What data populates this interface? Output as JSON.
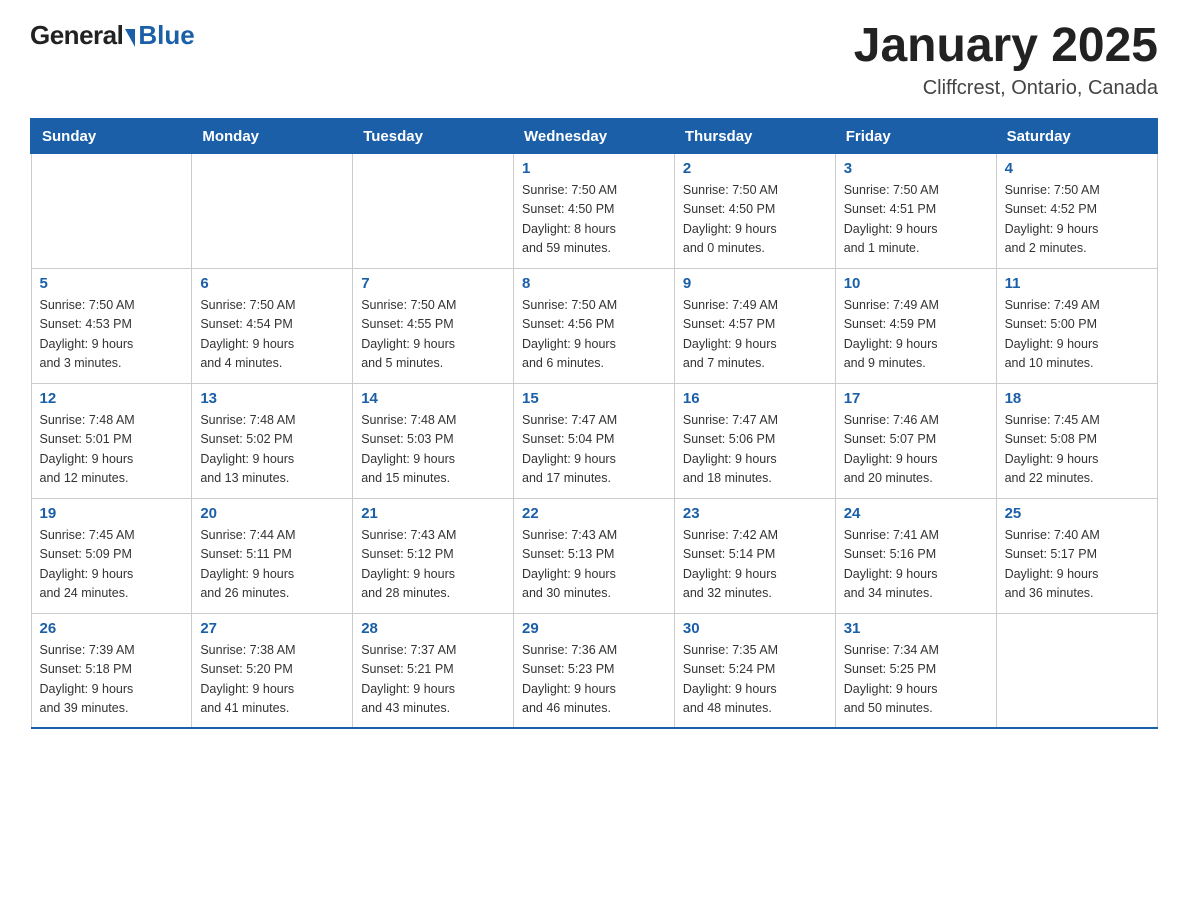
{
  "logo": {
    "general": "General",
    "blue": "Blue",
    "subtitle": ""
  },
  "header": {
    "month_year": "January 2025",
    "location": "Cliffcrest, Ontario, Canada"
  },
  "weekdays": [
    "Sunday",
    "Monday",
    "Tuesday",
    "Wednesday",
    "Thursday",
    "Friday",
    "Saturday"
  ],
  "weeks": [
    [
      {
        "day": "",
        "info": ""
      },
      {
        "day": "",
        "info": ""
      },
      {
        "day": "",
        "info": ""
      },
      {
        "day": "1",
        "info": "Sunrise: 7:50 AM\nSunset: 4:50 PM\nDaylight: 8 hours\nand 59 minutes."
      },
      {
        "day": "2",
        "info": "Sunrise: 7:50 AM\nSunset: 4:50 PM\nDaylight: 9 hours\nand 0 minutes."
      },
      {
        "day": "3",
        "info": "Sunrise: 7:50 AM\nSunset: 4:51 PM\nDaylight: 9 hours\nand 1 minute."
      },
      {
        "day": "4",
        "info": "Sunrise: 7:50 AM\nSunset: 4:52 PM\nDaylight: 9 hours\nand 2 minutes."
      }
    ],
    [
      {
        "day": "5",
        "info": "Sunrise: 7:50 AM\nSunset: 4:53 PM\nDaylight: 9 hours\nand 3 minutes."
      },
      {
        "day": "6",
        "info": "Sunrise: 7:50 AM\nSunset: 4:54 PM\nDaylight: 9 hours\nand 4 minutes."
      },
      {
        "day": "7",
        "info": "Sunrise: 7:50 AM\nSunset: 4:55 PM\nDaylight: 9 hours\nand 5 minutes."
      },
      {
        "day": "8",
        "info": "Sunrise: 7:50 AM\nSunset: 4:56 PM\nDaylight: 9 hours\nand 6 minutes."
      },
      {
        "day": "9",
        "info": "Sunrise: 7:49 AM\nSunset: 4:57 PM\nDaylight: 9 hours\nand 7 minutes."
      },
      {
        "day": "10",
        "info": "Sunrise: 7:49 AM\nSunset: 4:59 PM\nDaylight: 9 hours\nand 9 minutes."
      },
      {
        "day": "11",
        "info": "Sunrise: 7:49 AM\nSunset: 5:00 PM\nDaylight: 9 hours\nand 10 minutes."
      }
    ],
    [
      {
        "day": "12",
        "info": "Sunrise: 7:48 AM\nSunset: 5:01 PM\nDaylight: 9 hours\nand 12 minutes."
      },
      {
        "day": "13",
        "info": "Sunrise: 7:48 AM\nSunset: 5:02 PM\nDaylight: 9 hours\nand 13 minutes."
      },
      {
        "day": "14",
        "info": "Sunrise: 7:48 AM\nSunset: 5:03 PM\nDaylight: 9 hours\nand 15 minutes."
      },
      {
        "day": "15",
        "info": "Sunrise: 7:47 AM\nSunset: 5:04 PM\nDaylight: 9 hours\nand 17 minutes."
      },
      {
        "day": "16",
        "info": "Sunrise: 7:47 AM\nSunset: 5:06 PM\nDaylight: 9 hours\nand 18 minutes."
      },
      {
        "day": "17",
        "info": "Sunrise: 7:46 AM\nSunset: 5:07 PM\nDaylight: 9 hours\nand 20 minutes."
      },
      {
        "day": "18",
        "info": "Sunrise: 7:45 AM\nSunset: 5:08 PM\nDaylight: 9 hours\nand 22 minutes."
      }
    ],
    [
      {
        "day": "19",
        "info": "Sunrise: 7:45 AM\nSunset: 5:09 PM\nDaylight: 9 hours\nand 24 minutes."
      },
      {
        "day": "20",
        "info": "Sunrise: 7:44 AM\nSunset: 5:11 PM\nDaylight: 9 hours\nand 26 minutes."
      },
      {
        "day": "21",
        "info": "Sunrise: 7:43 AM\nSunset: 5:12 PM\nDaylight: 9 hours\nand 28 minutes."
      },
      {
        "day": "22",
        "info": "Sunrise: 7:43 AM\nSunset: 5:13 PM\nDaylight: 9 hours\nand 30 minutes."
      },
      {
        "day": "23",
        "info": "Sunrise: 7:42 AM\nSunset: 5:14 PM\nDaylight: 9 hours\nand 32 minutes."
      },
      {
        "day": "24",
        "info": "Sunrise: 7:41 AM\nSunset: 5:16 PM\nDaylight: 9 hours\nand 34 minutes."
      },
      {
        "day": "25",
        "info": "Sunrise: 7:40 AM\nSunset: 5:17 PM\nDaylight: 9 hours\nand 36 minutes."
      }
    ],
    [
      {
        "day": "26",
        "info": "Sunrise: 7:39 AM\nSunset: 5:18 PM\nDaylight: 9 hours\nand 39 minutes."
      },
      {
        "day": "27",
        "info": "Sunrise: 7:38 AM\nSunset: 5:20 PM\nDaylight: 9 hours\nand 41 minutes."
      },
      {
        "day": "28",
        "info": "Sunrise: 7:37 AM\nSunset: 5:21 PM\nDaylight: 9 hours\nand 43 minutes."
      },
      {
        "day": "29",
        "info": "Sunrise: 7:36 AM\nSunset: 5:23 PM\nDaylight: 9 hours\nand 46 minutes."
      },
      {
        "day": "30",
        "info": "Sunrise: 7:35 AM\nSunset: 5:24 PM\nDaylight: 9 hours\nand 48 minutes."
      },
      {
        "day": "31",
        "info": "Sunrise: 7:34 AM\nSunset: 5:25 PM\nDaylight: 9 hours\nand 50 minutes."
      },
      {
        "day": "",
        "info": ""
      }
    ]
  ]
}
